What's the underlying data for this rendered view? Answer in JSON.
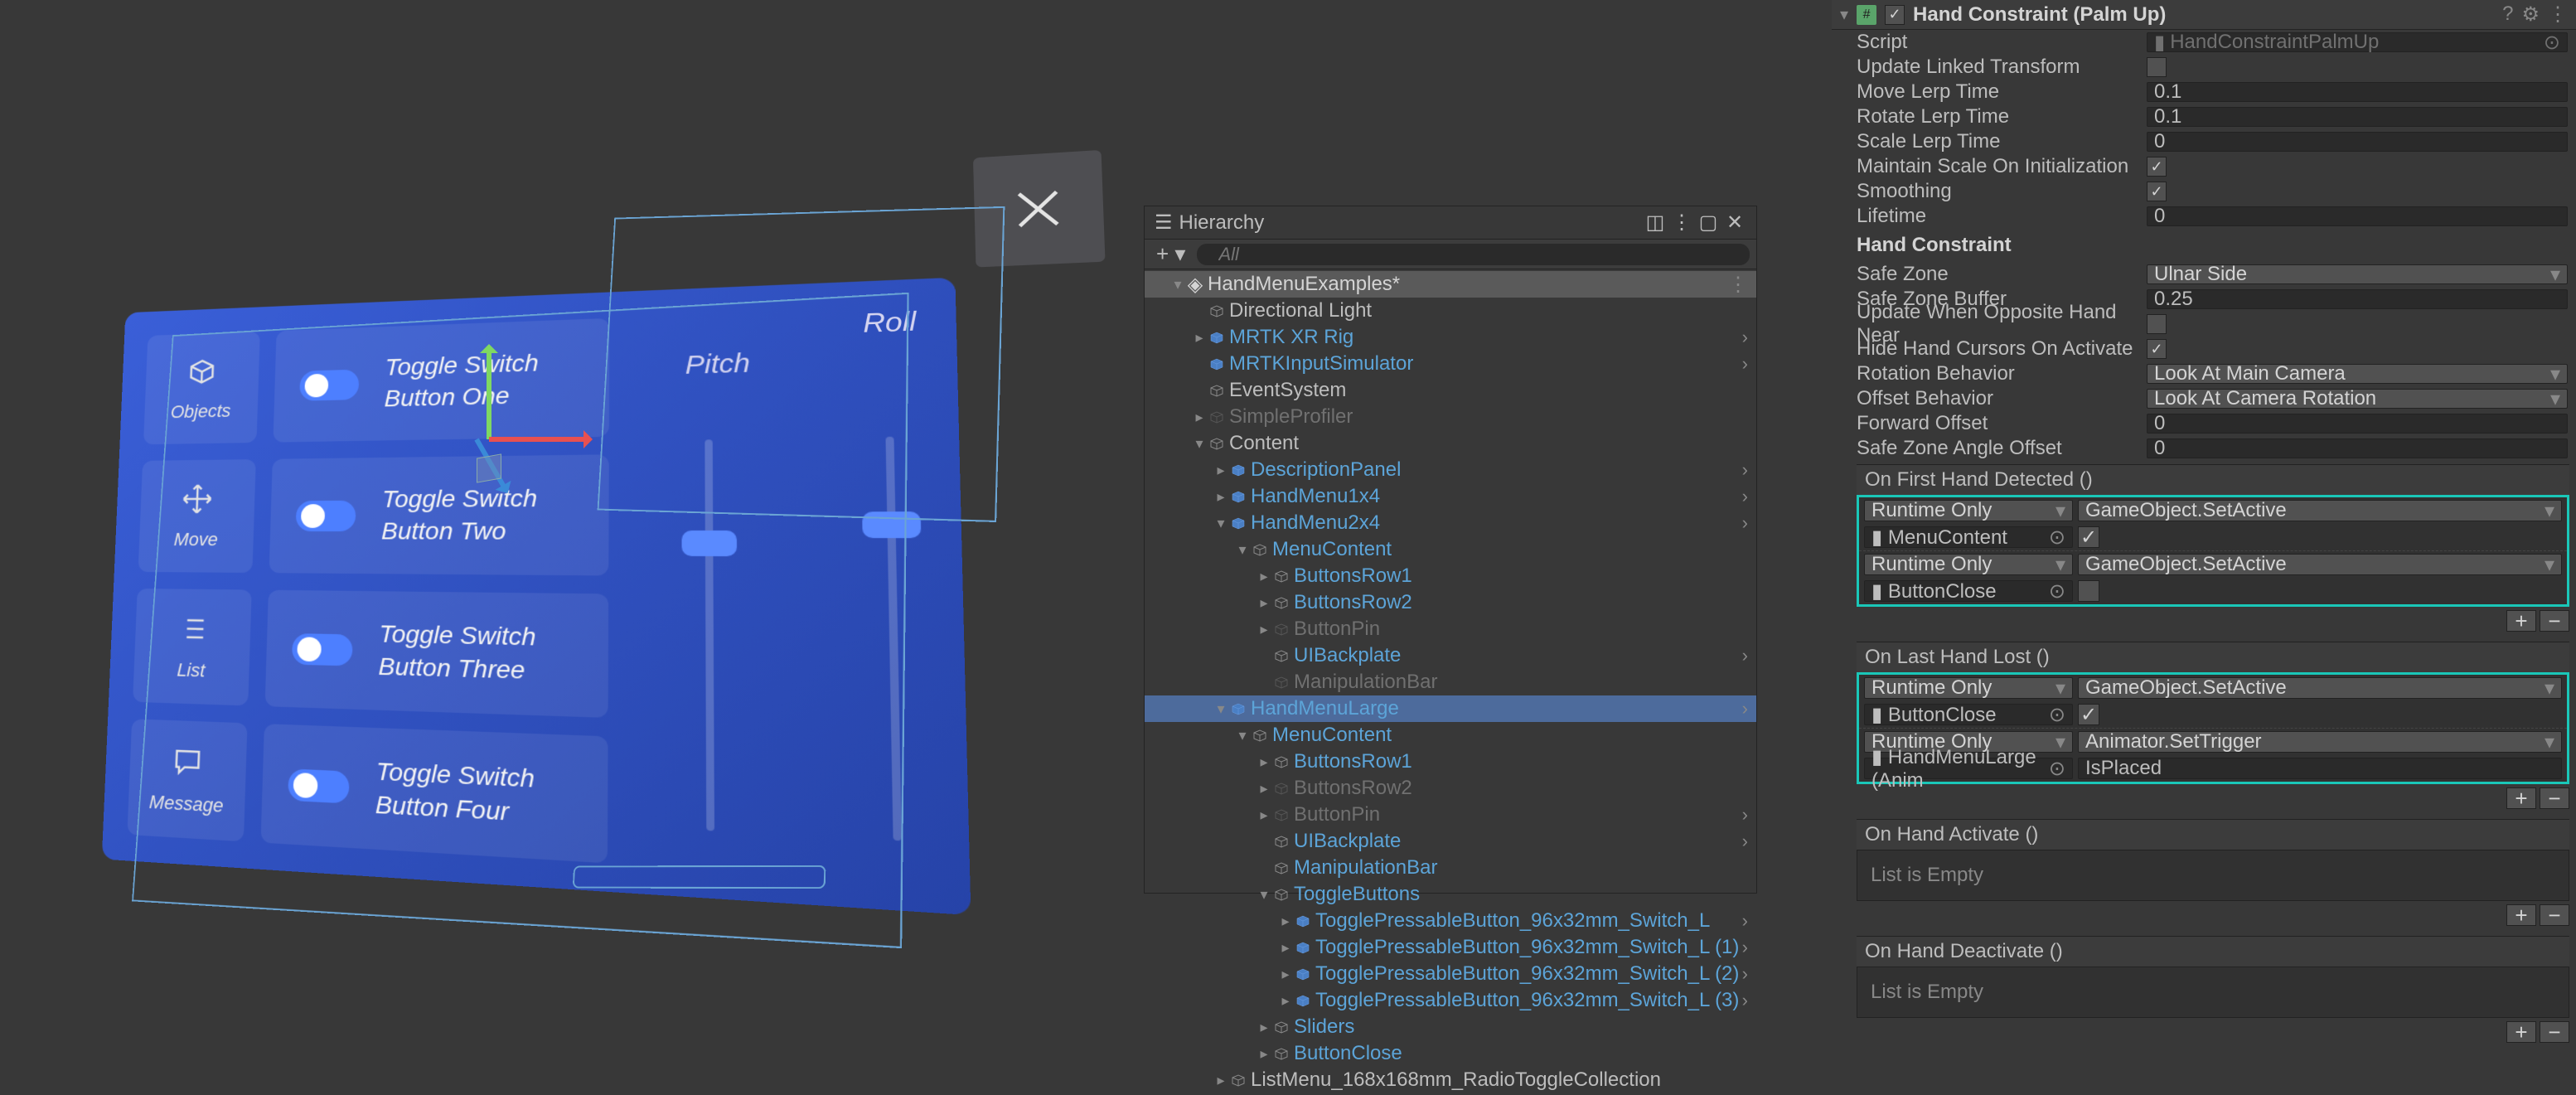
{
  "scene_menu": {
    "tiles_left": [
      {
        "icon": "objects",
        "label": "Objects"
      },
      {
        "icon": "move",
        "label": "Move"
      },
      {
        "icon": "list",
        "label": "List"
      },
      {
        "icon": "message",
        "label": "Message"
      }
    ],
    "toggles": [
      "Toggle Switch\nButton One",
      "Toggle Switch\nButton Two",
      "Toggle Switch\nButton Three",
      "Toggle Switch\nButton Four"
    ],
    "sliders": [
      "Pitch",
      "Roll"
    ]
  },
  "hierarchy": {
    "title": "Hierarchy",
    "search_placeholder": "All",
    "scene": "HandMenuExamples*",
    "items": [
      {
        "d": 1,
        "a": "",
        "i": "cube",
        "t": "Directional Light",
        "c": ""
      },
      {
        "d": 1,
        "a": "▸",
        "i": "prefab",
        "t": "MRTK XR Rig",
        "c": "blue",
        "r": "›"
      },
      {
        "d": 1,
        "a": "",
        "i": "prefab",
        "t": "MRTKInputSimulator",
        "c": "blue",
        "r": "›"
      },
      {
        "d": 1,
        "a": "",
        "i": "cube",
        "t": "EventSystem",
        "c": ""
      },
      {
        "d": 1,
        "a": "▸",
        "i": "dim",
        "t": "SimpleProfiler",
        "c": "dim"
      },
      {
        "d": 1,
        "a": "▾",
        "i": "cube",
        "t": "Content",
        "c": ""
      },
      {
        "d": 2,
        "a": "▸",
        "i": "prefab",
        "t": "DescriptionPanel",
        "c": "blue",
        "r": "›"
      },
      {
        "d": 2,
        "a": "▸",
        "i": "prefab",
        "t": "HandMenu1x4",
        "c": "blue",
        "r": "›"
      },
      {
        "d": 2,
        "a": "▾",
        "i": "prefab",
        "t": "HandMenu2x4",
        "c": "blue",
        "r": "›"
      },
      {
        "d": 3,
        "a": "▾",
        "i": "cube",
        "t": "MenuContent",
        "c": "blue"
      },
      {
        "d": 4,
        "a": "▸",
        "i": "cube",
        "t": "ButtonsRow1",
        "c": "blue"
      },
      {
        "d": 4,
        "a": "▸",
        "i": "cube",
        "t": "ButtonsRow2",
        "c": "blue"
      },
      {
        "d": 4,
        "a": "▸",
        "i": "dim",
        "t": "ButtonPin",
        "c": "dim"
      },
      {
        "d": 4,
        "a": "",
        "i": "cube",
        "t": "UIBackplate",
        "c": "blue",
        "r": "›"
      },
      {
        "d": 4,
        "a": "",
        "i": "dim",
        "t": "ManipulationBar",
        "c": "dim"
      },
      {
        "d": 2,
        "a": "▾",
        "i": "prefab",
        "t": "HandMenuLarge",
        "c": "blue",
        "sel": true,
        "r": "›"
      },
      {
        "d": 3,
        "a": "▾",
        "i": "cube",
        "t": "MenuContent",
        "c": "blue"
      },
      {
        "d": 4,
        "a": "▸",
        "i": "cube",
        "t": "ButtonsRow1",
        "c": "blue"
      },
      {
        "d": 4,
        "a": "▸",
        "i": "dim",
        "t": "ButtonsRow2",
        "c": "dim"
      },
      {
        "d": 4,
        "a": "▸",
        "i": "dim",
        "t": "ButtonPin",
        "c": "dim",
        "r": "›"
      },
      {
        "d": 4,
        "a": "",
        "i": "cube",
        "t": "UIBackplate",
        "c": "blue",
        "r": "›"
      },
      {
        "d": 4,
        "a": "",
        "i": "cube",
        "t": "ManipulationBar",
        "c": "blue"
      },
      {
        "d": 4,
        "a": "▾",
        "i": "cube",
        "t": "ToggleButtons",
        "c": "blue"
      },
      {
        "d": 5,
        "a": "▸",
        "i": "prefab",
        "t": "TogglePressableButton_96x32mm_Switch_L",
        "c": "blue",
        "r": "›"
      },
      {
        "d": 5,
        "a": "▸",
        "i": "prefab",
        "t": "TogglePressableButton_96x32mm_Switch_L (1)",
        "c": "blue",
        "r": "›"
      },
      {
        "d": 5,
        "a": "▸",
        "i": "prefab",
        "t": "TogglePressableButton_96x32mm_Switch_L (2)",
        "c": "blue",
        "r": "›"
      },
      {
        "d": 5,
        "a": "▸",
        "i": "prefab",
        "t": "TogglePressableButton_96x32mm_Switch_L (3)",
        "c": "blue",
        "r": "›"
      },
      {
        "d": 4,
        "a": "▸",
        "i": "cube",
        "t": "Sliders",
        "c": "blue"
      },
      {
        "d": 4,
        "a": "▸",
        "i": "cube",
        "t": "ButtonClose",
        "c": "blue"
      },
      {
        "d": 2,
        "a": "▸",
        "i": "cube",
        "t": "ListMenu_168x168mm_RadioToggleCollection",
        "c": ""
      }
    ]
  },
  "inspector": {
    "component_title": "Hand Constraint (Palm Up)",
    "enabled": true,
    "script": "HandConstraintPalmUp",
    "props": [
      {
        "l": "Script",
        "type": "obj",
        "v": "HandConstraintPalmUp",
        "readonly": true
      },
      {
        "l": "Update Linked Transform",
        "type": "check",
        "v": false
      },
      {
        "l": "Move Lerp Time",
        "type": "text",
        "v": "0.1"
      },
      {
        "l": "Rotate Lerp Time",
        "type": "text",
        "v": "0.1"
      },
      {
        "l": "Scale Lerp Time",
        "type": "text",
        "v": "0"
      },
      {
        "l": "Maintain Scale On Initialization",
        "type": "check",
        "v": true
      },
      {
        "l": "Smoothing",
        "type": "check",
        "v": true
      },
      {
        "l": "Lifetime",
        "type": "text",
        "v": "0"
      }
    ],
    "section": "Hand Constraint",
    "props2": [
      {
        "l": "Safe Zone",
        "type": "dd",
        "v": "Ulnar Side"
      },
      {
        "l": "Safe Zone Buffer",
        "type": "text",
        "v": "0.25"
      },
      {
        "l": "Update When Opposite Hand Near",
        "type": "check",
        "v": false
      },
      {
        "l": "Hide Hand Cursors On Activate",
        "type": "check",
        "v": true
      },
      {
        "l": "Rotation Behavior",
        "type": "dd",
        "v": "Look At Main Camera"
      },
      {
        "l": "Offset Behavior",
        "type": "dd",
        "v": "Look At Camera Rotation"
      },
      {
        "l": "Forward Offset",
        "type": "text",
        "v": "0"
      },
      {
        "l": "Safe Zone Angle Offset",
        "type": "text",
        "v": "0"
      }
    ],
    "events": [
      {
        "title": "On First Hand Detected ()",
        "highlight": true,
        "entries": [
          {
            "mode": "Runtime Only",
            "func": "GameObject.SetActive",
            "obj": "MenuContent",
            "arg": "check",
            "argv": true
          },
          {
            "mode": "Runtime Only",
            "func": "GameObject.SetActive",
            "obj": "ButtonClose",
            "arg": "check",
            "argv": false
          }
        ]
      },
      {
        "title": "On Last Hand Lost ()",
        "highlight": true,
        "entries": [
          {
            "mode": "Runtime Only",
            "func": "GameObject.SetActive",
            "obj": "ButtonClose",
            "arg": "check",
            "argv": true
          },
          {
            "mode": "Runtime Only",
            "func": "Animator.SetTrigger",
            "obj": "HandMenuLarge (Anim",
            "arg": "text",
            "argv": "IsPlaced"
          }
        ]
      },
      {
        "title": "On Hand Activate ()",
        "highlight": false,
        "empty": "List is Empty"
      },
      {
        "title": "On Hand Deactivate ()",
        "highlight": false,
        "empty": "List is Empty"
      }
    ]
  }
}
